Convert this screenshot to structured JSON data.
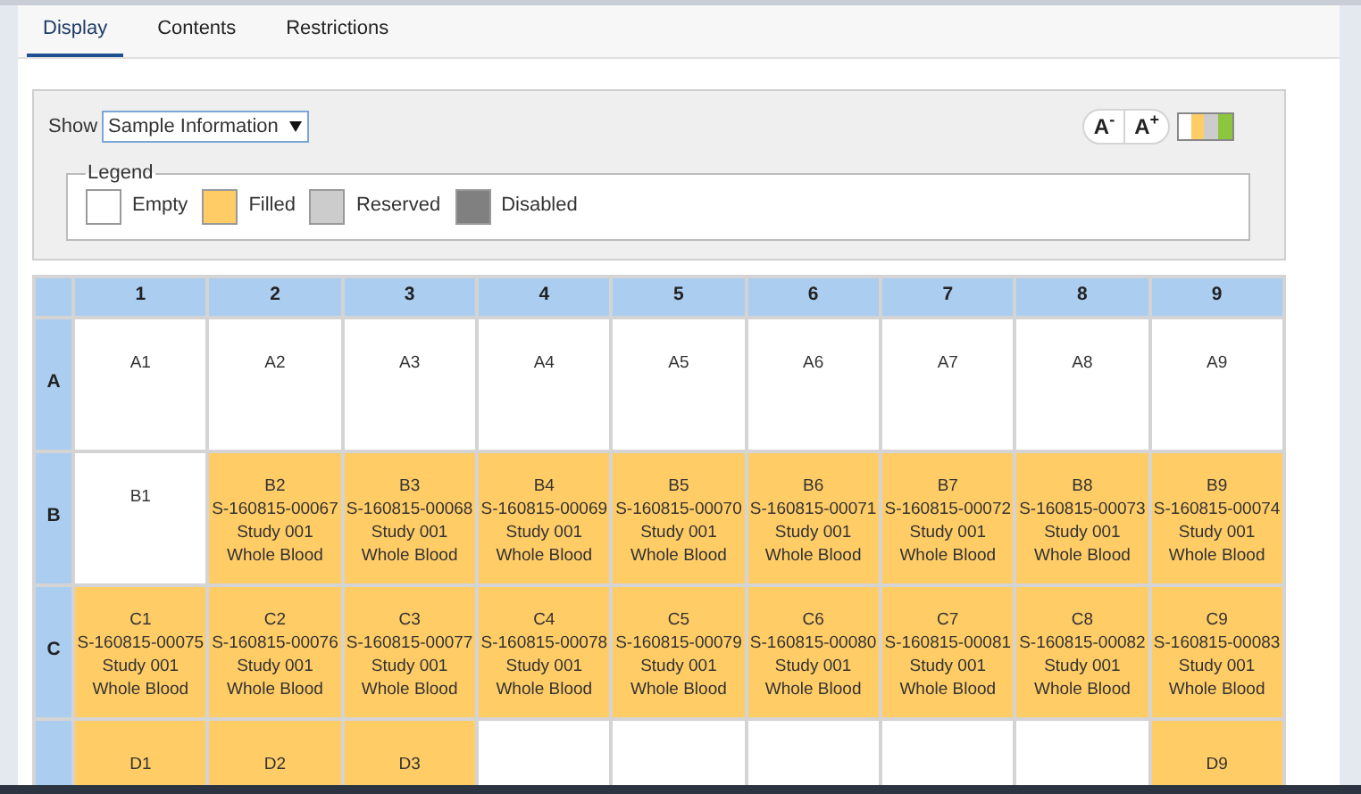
{
  "tabs": [
    {
      "label": "Display",
      "selected": true
    },
    {
      "label": "Contents",
      "selected": false
    },
    {
      "label": "Restrictions",
      "selected": false
    }
  ],
  "show": {
    "label": "Show",
    "value": "Sample Information"
  },
  "font_buttons": [
    {
      "label": "A$^{-}$"
    },
    {
      "label": "A$^{+}$"
    }
  ],
  "legend": {
    "title": "Legend",
    "items": [
      {
        "label": "Empty",
        "color": "#ffffff"
      },
      {
        "label": "Filled",
        "color": "#ffcc66"
      },
      {
        "label": "Reserved",
        "color": "#cccccc"
      },
      {
        "label": "Disabled",
        "color": "#808080"
      }
    ]
  },
  "grid": {
    "columns": [
      "1",
      "2",
      "3",
      "4",
      "5",
      "6",
      "7",
      "8",
      "9"
    ],
    "rows": [
      {
        "label": "A",
        "cells": [
          {
            "color": "#ffffff",
            "lines": [
              "A1"
            ]
          },
          {
            "color": "#ffffff",
            "lines": [
              "A2"
            ]
          },
          {
            "color": "#ffffff",
            "lines": [
              "A3"
            ]
          },
          {
            "color": "#ffffff",
            "lines": [
              "A4"
            ]
          },
          {
            "color": "#ffffff",
            "lines": [
              "A5"
            ]
          },
          {
            "color": "#ffffff",
            "lines": [
              "A6"
            ]
          },
          {
            "color": "#ffffff",
            "lines": [
              "A7"
            ]
          },
          {
            "color": "#ffffff",
            "lines": [
              "A8"
            ]
          },
          {
            "color": "#ffffff",
            "lines": [
              "A9"
            ]
          }
        ]
      },
      {
        "label": "B",
        "cells": [
          {
            "color": "#ffffff",
            "lines": [
              "B1"
            ]
          },
          {
            "color": "#ffcc66",
            "lines": [
              "B2",
              "S-160815-00067",
              "Study 001",
              "Whole Blood"
            ]
          },
          {
            "color": "#ffcc66",
            "lines": [
              "B3",
              "S-160815-00068",
              "Study 001",
              "Whole Blood"
            ]
          },
          {
            "color": "#ffcc66",
            "lines": [
              "B4",
              "S-160815-00069",
              "Study 001",
              "Whole Blood"
            ]
          },
          {
            "color": "#ffcc66",
            "lines": [
              "B5",
              "S-160815-00070",
              "Study 001",
              "Whole Blood"
            ]
          },
          {
            "color": "#ffcc66",
            "lines": [
              "B6",
              "S-160815-00071",
              "Study 001",
              "Whole Blood"
            ]
          },
          {
            "color": "#ffcc66",
            "lines": [
              "B7",
              "S-160815-00072",
              "Study 001",
              "Whole Blood"
            ]
          },
          {
            "color": "#ffcc66",
            "lines": [
              "B8",
              "S-160815-00073",
              "Study 001",
              "Whole Blood"
            ]
          },
          {
            "color": "#ffcc66",
            "lines": [
              "B9",
              "S-160815-00074",
              "Study 001",
              "Whole Blood"
            ]
          }
        ]
      },
      {
        "label": "C",
        "cells": [
          {
            "color": "#ffcc66",
            "lines": [
              "C1",
              "S-160815-00075",
              "Study 001",
              "Whole Blood"
            ]
          },
          {
            "color": "#ffcc66",
            "lines": [
              "C2",
              "S-160815-00076",
              "Study 001",
              "Whole Blood"
            ]
          },
          {
            "color": "#ffcc66",
            "lines": [
              "C3",
              "S-160815-00077",
              "Study 001",
              "Whole Blood"
            ]
          },
          {
            "color": "#ffcc66",
            "lines": [
              "C4",
              "S-160815-00078",
              "Study 001",
              "Whole Blood"
            ]
          },
          {
            "color": "#ffcc66",
            "lines": [
              "C5",
              "S-160815-00079",
              "Study 001",
              "Whole Blood"
            ]
          },
          {
            "color": "#ffcc66",
            "lines": [
              "C6",
              "S-160815-00080",
              "Study 001",
              "Whole Blood"
            ]
          },
          {
            "color": "#ffcc66",
            "lines": [
              "C7",
              "S-160815-00081",
              "Study 001",
              "Whole Blood"
            ]
          },
          {
            "color": "#ffcc66",
            "lines": [
              "C8",
              "S-160815-00082",
              "Study 001",
              "Whole Blood"
            ]
          },
          {
            "color": "#ffcc66",
            "lines": [
              "C9",
              "S-160815-00083",
              "Study 001",
              "Whole Blood"
            ]
          }
        ]
      },
      {
        "cells": [
          {
            "color": "#ffcc66",
            "lines": [
              "D1"
            ]
          },
          {
            "color": "#ffcc66",
            "lines": [
              "D2"
            ]
          },
          {
            "color": "#ffcc66",
            "lines": [
              "D3"
            ]
          },
          {
            "color": "#ffffff"
          },
          {
            "color": "#ffffff"
          },
          {
            "color": "#ffffff"
          },
          {
            "color": "#ffffff"
          },
          {
            "color": "#ffffff"
          },
          {
            "color": "#ffcc66",
            "lines": [
              "D9"
            ]
          }
        ]
      }
    ]
  }
}
